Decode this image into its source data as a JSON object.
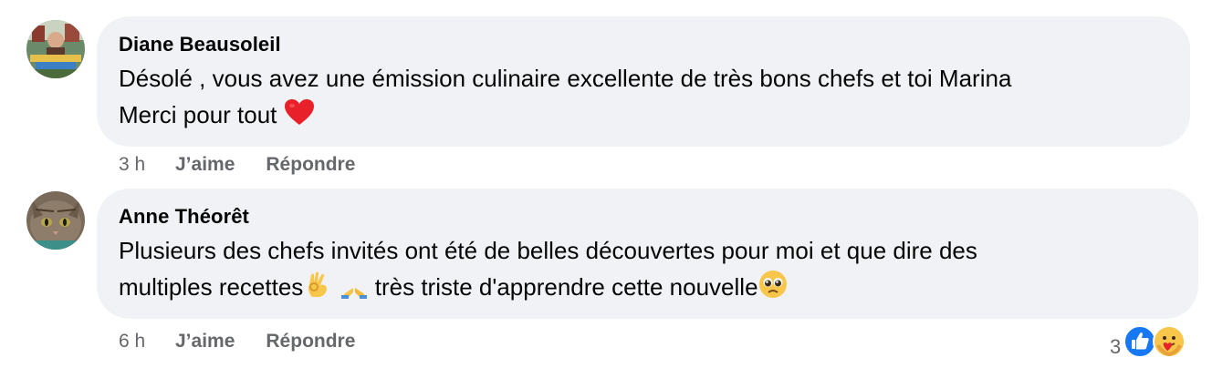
{
  "comments": [
    {
      "author": "Diane Beausoleil",
      "line1": "Désolé , vous avez une émission culinaire excellente de très bons chefs et toi Marina",
      "line2": "Merci pour tout",
      "line2_emoji": "red-heart",
      "time": "3 h",
      "like_label": "J’aime",
      "reply_label": "Répondre",
      "avatar_icon": "profile-photo-diane"
    },
    {
      "author": "Anne Théorêt",
      "line1": "Plusieurs des chefs invités ont été de belles découvertes pour moi et que dire des",
      "line2_a": "multiples recettes",
      "line2_emojis": [
        "ok-hand",
        "folded-hands"
      ],
      "line2_b": " très triste d'apprendre cette nouvelle",
      "line2_end_emoji": "pleading-face",
      "time": "6 h",
      "like_label": "J’aime",
      "reply_label": "Répondre",
      "reaction_count": "3",
      "reaction_icons": [
        "like-reaction-icon",
        "care-reaction-icon"
      ],
      "avatar_icon": "profile-photo-cat"
    }
  ],
  "colors": {
    "bubble": "#f0f2f5",
    "secondary_text": "#65676b",
    "like_blue": "#1877f2"
  }
}
